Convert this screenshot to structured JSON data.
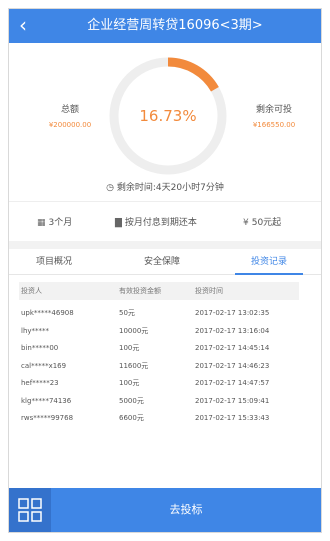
{
  "header": {
    "back_icon": "chevron-left-icon",
    "title": "企业经营周转贷16096<3期>"
  },
  "summary": {
    "progress_label": "16.73%",
    "progress_fraction": 0.1673,
    "total_label": "总额",
    "total_value": "¥200000.00",
    "remaining_label": "剩余可投",
    "remaining_value": "¥166550.00",
    "countdown": "剩余时间:4天20小时7分钟",
    "colors": {
      "accent": "#f28a3c",
      "primary": "#3f86e6"
    }
  },
  "features": [
    {
      "icon": "calendar-icon",
      "label": "3个月"
    },
    {
      "icon": "bar-chart-icon",
      "label": "按月付息到期还本"
    },
    {
      "icon": "yen-icon",
      "label": "50元起"
    }
  ],
  "tabs": [
    {
      "label": "项目概况"
    },
    {
      "label": "安全保障"
    },
    {
      "label": "投资记录",
      "active": true
    }
  ],
  "records": {
    "columns": [
      "投资人",
      "有效投资金额",
      "投资时间"
    ],
    "rows": [
      {
        "investor": "upk*****46908",
        "amount": "50元",
        "time": "2017-02-17 13:02:35"
      },
      {
        "investor": "lhy*****",
        "amount": "10000元",
        "time": "2017-02-17 13:16:04"
      },
      {
        "investor": "bin*****00",
        "amount": "100元",
        "time": "2017-02-17 14:45:14"
      },
      {
        "investor": "cal*****x169",
        "amount": "11600元",
        "time": "2017-02-17 14:46:23"
      },
      {
        "investor": "hef*****23",
        "amount": "100元",
        "time": "2017-02-17 14:47:57"
      },
      {
        "investor": "klg*****74136",
        "amount": "5000元",
        "time": "2017-02-17 15:09:41"
      },
      {
        "investor": "rws*****99768",
        "amount": "6600元",
        "time": "2017-02-17 15:33:43"
      }
    ]
  },
  "footer": {
    "menu_icon": "grid-menu-icon",
    "invest_label": "去投标"
  }
}
